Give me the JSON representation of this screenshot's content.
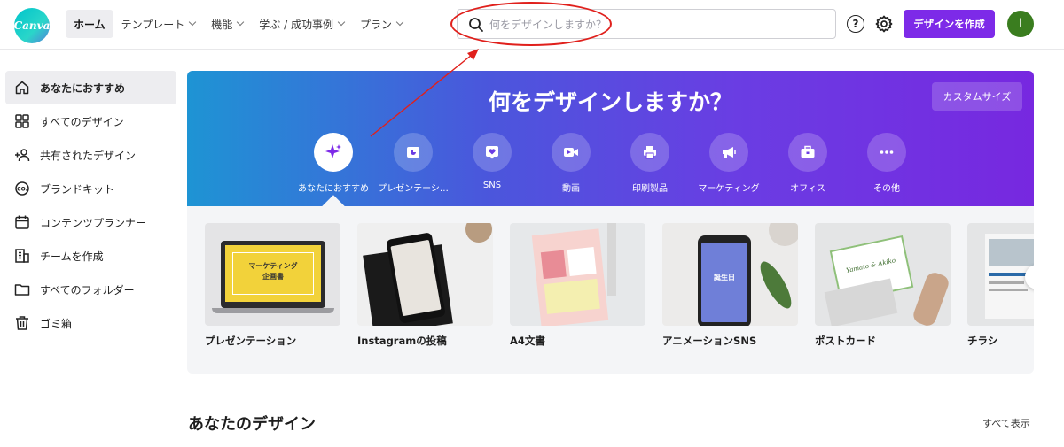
{
  "app": {
    "logo_text": "Canva"
  },
  "nav": {
    "items": [
      {
        "label": "ホーム",
        "dropdown": false
      },
      {
        "label": "テンプレート",
        "dropdown": true
      },
      {
        "label": "機能",
        "dropdown": true
      },
      {
        "label": "学ぶ / 成功事例",
        "dropdown": true
      },
      {
        "label": "プラン",
        "dropdown": true
      }
    ]
  },
  "search": {
    "placeholder": "何をデザインしますか？",
    "value": ""
  },
  "header": {
    "help_label": "?",
    "create_label": "デザインを作成",
    "avatar_initial": "I"
  },
  "sidebar": {
    "items": [
      {
        "label": "あなたにおすすめ",
        "icon": "home-icon"
      },
      {
        "label": "すべてのデザイン",
        "icon": "grid-icon"
      },
      {
        "label": "共有されたデザイン",
        "icon": "people-icon"
      },
      {
        "label": "ブランドキット",
        "icon": "brand-icon"
      },
      {
        "label": "コンテンツプランナー",
        "icon": "calendar-icon"
      },
      {
        "label": "チームを作成",
        "icon": "building-icon"
      },
      {
        "label": "すべてのフォルダー",
        "icon": "folder-icon"
      },
      {
        "label": "ゴミ箱",
        "icon": "trash-icon"
      }
    ]
  },
  "hero": {
    "title": "何をデザインしますか？",
    "custom_size_label": "カスタムサイズ",
    "categories": [
      {
        "label": "あなたにおすすめ",
        "icon": "sparkle-icon"
      },
      {
        "label": "プレゼンテーシ…",
        "icon": "presentation-icon"
      },
      {
        "label": "SNS",
        "icon": "heart-icon"
      },
      {
        "label": "動画",
        "icon": "video-icon"
      },
      {
        "label": "印刷製品",
        "icon": "printer-icon"
      },
      {
        "label": "マーケティング",
        "icon": "megaphone-icon"
      },
      {
        "label": "オフィス",
        "icon": "briefcase-icon"
      },
      {
        "label": "その他",
        "icon": "more-icon"
      }
    ]
  },
  "cards": [
    {
      "label": "プレゼンテーション",
      "thumb_title": "マーケティング",
      "thumb_sub": "企画書"
    },
    {
      "label": "Instagramの投稿"
    },
    {
      "label": "A4文書"
    },
    {
      "label": "アニメーションSNS",
      "thumb_text": "誕生日"
    },
    {
      "label": "ポストカード",
      "thumb_text": "Yamato & Akiko"
    },
    {
      "label": "チラシ"
    }
  ],
  "section": {
    "title": "あなたのデザイン",
    "see_all": "すべて表示"
  },
  "colors": {
    "accent": "#7d2ae8",
    "annotation": "#e0201c",
    "canva_teal": "#00c4cc"
  }
}
